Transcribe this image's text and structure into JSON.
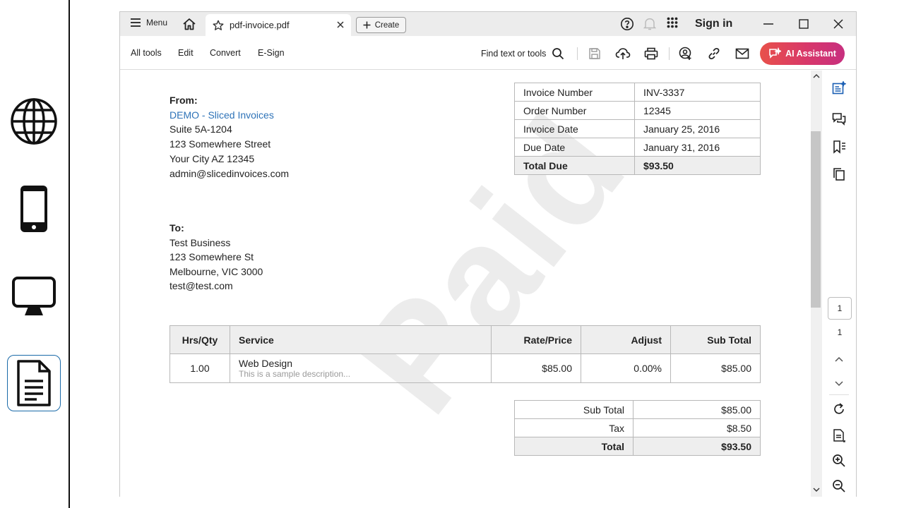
{
  "toolbar_top": {
    "menu_label": "Menu",
    "tab_title": "pdf-invoice.pdf",
    "create_label": "Create",
    "signin_label": "Sign in"
  },
  "toolbar": {
    "all_tools": "All tools",
    "edit": "Edit",
    "convert": "Convert",
    "esign": "E-Sign",
    "find_label": "Find text or tools",
    "ai_label": "AI Assistant"
  },
  "invoice": {
    "from_label": "From:",
    "from_company": "DEMO - Sliced Invoices",
    "from_lines": [
      "Suite 5A-1204",
      "123 Somewhere Street",
      "Your City AZ 12345",
      "admin@slicedinvoices.com"
    ],
    "to_label": "To:",
    "to_lines": [
      "Test Business",
      "123 Somewhere St",
      "Melbourne, VIC 3000",
      "test@test.com"
    ],
    "info": [
      {
        "label": "Invoice Number",
        "value": "INV-3337"
      },
      {
        "label": "Order Number",
        "value": "12345"
      },
      {
        "label": "Invoice Date",
        "value": "January 25, 2016"
      },
      {
        "label": "Due Date",
        "value": "January 31, 2016"
      },
      {
        "label": "Total Due",
        "value": "$93.50"
      }
    ],
    "columns": [
      "Hrs/Qty",
      "Service",
      "Rate/Price",
      "Adjust",
      "Sub Total"
    ],
    "item": {
      "qty": "1.00",
      "service": "Web Design",
      "description": "This is a sample description...",
      "rate": "$85.00",
      "adjust": "0.00%",
      "subtotal": "$85.00"
    },
    "totals": [
      {
        "label": "Sub Total",
        "value": "$85.00"
      },
      {
        "label": "Tax",
        "value": "$8.50"
      },
      {
        "label": "Total",
        "value": "$93.50"
      }
    ],
    "watermark": "Paid"
  },
  "pager": {
    "current_page": "1",
    "total_pages": "1"
  },
  "colors": {
    "link": "#2e73b8",
    "ai_gradient_start": "#e8514a",
    "ai_gradient_end": "#c72f7f",
    "rail_active_border": "#1a6aa8"
  }
}
